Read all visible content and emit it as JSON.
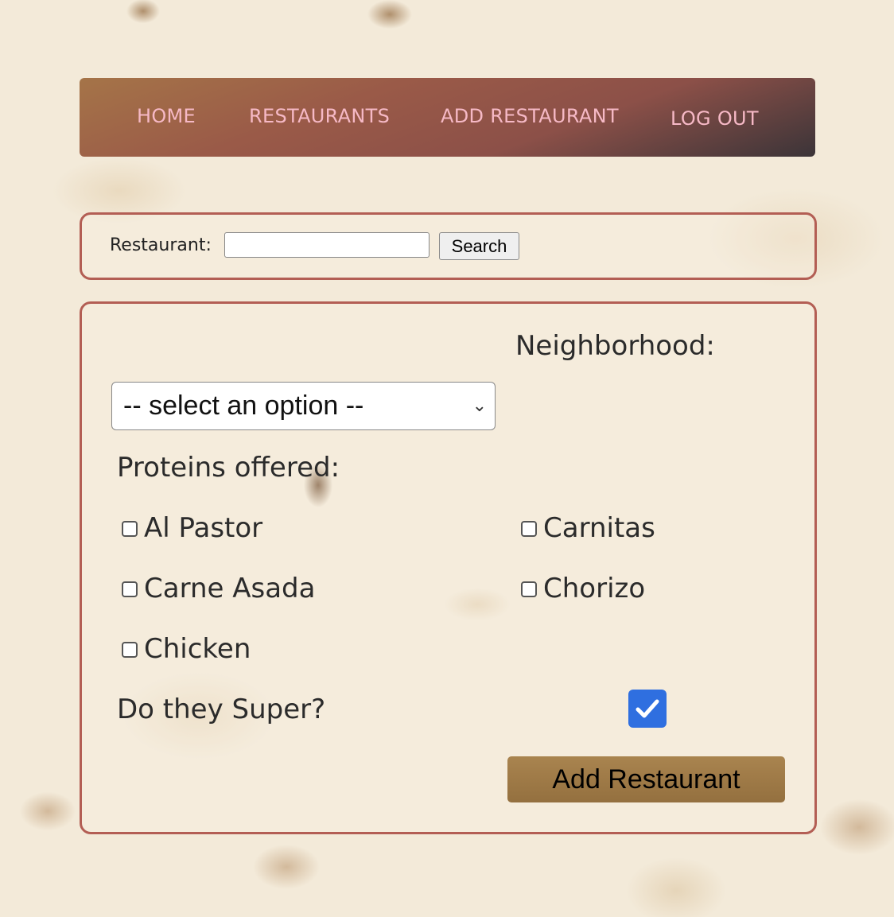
{
  "nav": {
    "home": "HOME",
    "restaurants": "RESTAURANTS",
    "add_restaurant": "ADD RESTAURANT",
    "log_out": "LOG OUT"
  },
  "search": {
    "label": "Restaurant:",
    "value": "",
    "button": "Search"
  },
  "form": {
    "neighborhood_label": "Neighborhood:",
    "neighborhood_selected": "-- select an option --",
    "proteins_label": "Proteins offered:",
    "proteins": [
      {
        "label": "Al Pastor",
        "checked": false
      },
      {
        "label": "Carnitas",
        "checked": false
      },
      {
        "label": "Carne Asada",
        "checked": false
      },
      {
        "label": "Chorizo",
        "checked": false
      },
      {
        "label": "Chicken",
        "checked": false
      }
    ],
    "super_label": "Do they Super?",
    "super_checked": true,
    "submit": "Add Restaurant"
  },
  "colors": {
    "nav_text": "#f6b9c6",
    "panel_border": "#b35e54",
    "checkbox_checked": "#2f6fe0",
    "submit_button": "#a07a48"
  }
}
